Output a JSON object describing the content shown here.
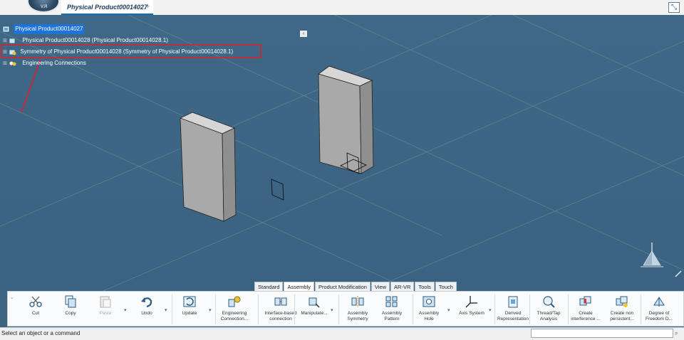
{
  "header": {
    "tab_title": "Physical Product00014027",
    "tab_add": "+",
    "logo_text": "V.R",
    "expand_glyph": "⤡"
  },
  "tree": {
    "collapse_glyph": "‹",
    "items": [
      {
        "label": "Physical Product00014027",
        "selected": true,
        "icon": "product-root-icon"
      },
      {
        "label": "Physical Product00014028 (Physical Product00014028.1)",
        "icon": "product-instance-icon"
      },
      {
        "label": "Symmetry of Physical Product00014028 (Symmetry of Physical Product00014028.1)",
        "icon": "symmetry-product-icon"
      },
      {
        "label": "Engineering Connections",
        "icon": "engineering-connections-icon"
      }
    ]
  },
  "action_bar": {
    "tabs": [
      "Standard",
      "Assembly",
      "Product Modification",
      "View",
      "AR-VR",
      "Tools",
      "Touch"
    ],
    "active_tab": "Assembly",
    "commands": [
      {
        "id": "cut",
        "label": "Cut",
        "icon": "scissors-icon"
      },
      {
        "id": "copy",
        "label": "Copy",
        "icon": "copy-icon"
      },
      {
        "id": "paste",
        "label": "Paste",
        "icon": "paste-icon",
        "disabled": true
      },
      {
        "id": "undo",
        "label": "Undo",
        "icon": "undo-icon"
      },
      {
        "id": "update",
        "label": "Update",
        "icon": "update-icon"
      },
      {
        "id": "engineering-connection",
        "label": "Engineering Connection...",
        "icon": "engineering-connection-icon"
      },
      {
        "id": "interface-based",
        "label": "Interface-based connection",
        "icon": "interface-connection-icon"
      },
      {
        "id": "manipulate",
        "label": "Manipulate...",
        "icon": "manipulate-icon"
      },
      {
        "id": "assembly-symmetry",
        "label": "Assembly Symmetry",
        "icon": "assembly-symmetry-icon"
      },
      {
        "id": "assembly-pattern",
        "label": "Assembly Pattern",
        "icon": "assembly-pattern-icon"
      },
      {
        "id": "assembly-hole",
        "label": "Assembly Hole",
        "icon": "assembly-hole-icon"
      },
      {
        "id": "axis-system",
        "label": "Axis System",
        "icon": "axis-system-icon"
      },
      {
        "id": "derived-representation",
        "label": "Derived Representation",
        "icon": "derived-representation-icon"
      },
      {
        "id": "thread-tap",
        "label": "Thread/Tap Analysis",
        "icon": "thread-tap-icon"
      },
      {
        "id": "create-interference",
        "label": "Create interference ...",
        "icon": "interference-icon"
      },
      {
        "id": "create-nonpersistent",
        "label": "Create non persistent...",
        "icon": "non-persistent-icon"
      },
      {
        "id": "degree-freedom",
        "label": "Degree of Freedom D...",
        "icon": "degree-of-freedom-icon"
      }
    ]
  },
  "status": {
    "message": "Select an object or a command",
    "command_input_value": ""
  },
  "colors": {
    "viewport": "#3d6582",
    "highlight_box": "#d9232d",
    "selection": "#1e73d8"
  }
}
